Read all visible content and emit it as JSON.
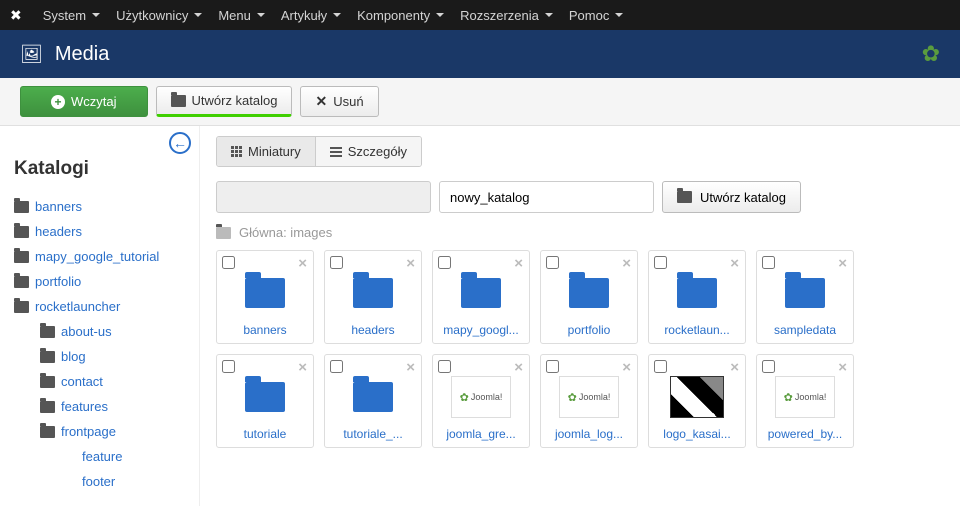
{
  "topbar": {
    "items": [
      "System",
      "Użytkownicy",
      "Menu",
      "Artykuły",
      "Komponenty",
      "Rozszerzenia",
      "Pomoc"
    ]
  },
  "header": {
    "title": "Media"
  },
  "toolbar": {
    "upload": "Wczytaj",
    "create_folder": "Utwórz katalog",
    "delete": "Usuń"
  },
  "sidebar": {
    "heading": "Katalogi",
    "tree": [
      {
        "label": "banners",
        "lvl": 0
      },
      {
        "label": "headers",
        "lvl": 0
      },
      {
        "label": "mapy_google_tutorial",
        "lvl": 0
      },
      {
        "label": "portfolio",
        "lvl": 0
      },
      {
        "label": "rocketlauncher",
        "lvl": 0
      },
      {
        "label": "about-us",
        "lvl": 1
      },
      {
        "label": "blog",
        "lvl": 1
      },
      {
        "label": "contact",
        "lvl": 1
      },
      {
        "label": "features",
        "lvl": 1
      },
      {
        "label": "frontpage",
        "lvl": 1
      },
      {
        "label": "feature",
        "lvl": 2
      },
      {
        "label": "footer",
        "lvl": 2
      }
    ]
  },
  "view": {
    "thumbnails": "Miniatury",
    "details": "Szczegóły"
  },
  "path_form": {
    "new_folder_value": "nowy_katalog",
    "create_label": "Utwórz katalog"
  },
  "breadcrumb": {
    "label": "Główna: images"
  },
  "tiles": [
    {
      "type": "folder",
      "label": "banners"
    },
    {
      "type": "folder",
      "label": "headers"
    },
    {
      "type": "folder",
      "label": "mapy_googl..."
    },
    {
      "type": "folder",
      "label": "portfolio"
    },
    {
      "type": "folder",
      "label": "rocketlaun..."
    },
    {
      "type": "folder",
      "label": "sampledata"
    },
    {
      "type": "folder",
      "label": "tutoriale"
    },
    {
      "type": "folder",
      "label": "tutoriale_..."
    },
    {
      "type": "image",
      "label": "joomla_gre...",
      "variant": "joomla-grey"
    },
    {
      "type": "image",
      "label": "joomla_log...",
      "variant": "joomla"
    },
    {
      "type": "image",
      "label": "logo_kasai...",
      "variant": "bw"
    },
    {
      "type": "image",
      "label": "powered_by...",
      "variant": "joomla"
    }
  ]
}
